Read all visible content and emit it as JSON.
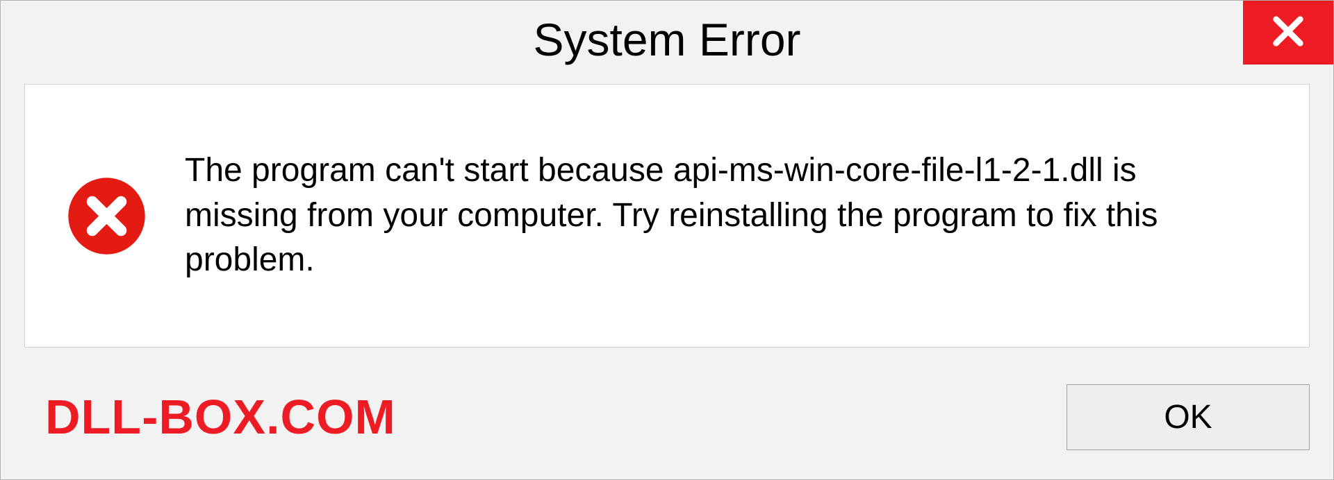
{
  "dialog": {
    "title": "System Error",
    "message": "The program can't start because api-ms-win-core-file-l1-2-1.dll is missing from your computer. Try reinstalling the program to fix this problem.",
    "ok_label": "OK"
  },
  "watermark": "DLL-BOX.COM",
  "colors": {
    "accent_red": "#ed1c24",
    "panel_bg": "#ffffff",
    "dialog_bg": "#f2f2f2"
  }
}
